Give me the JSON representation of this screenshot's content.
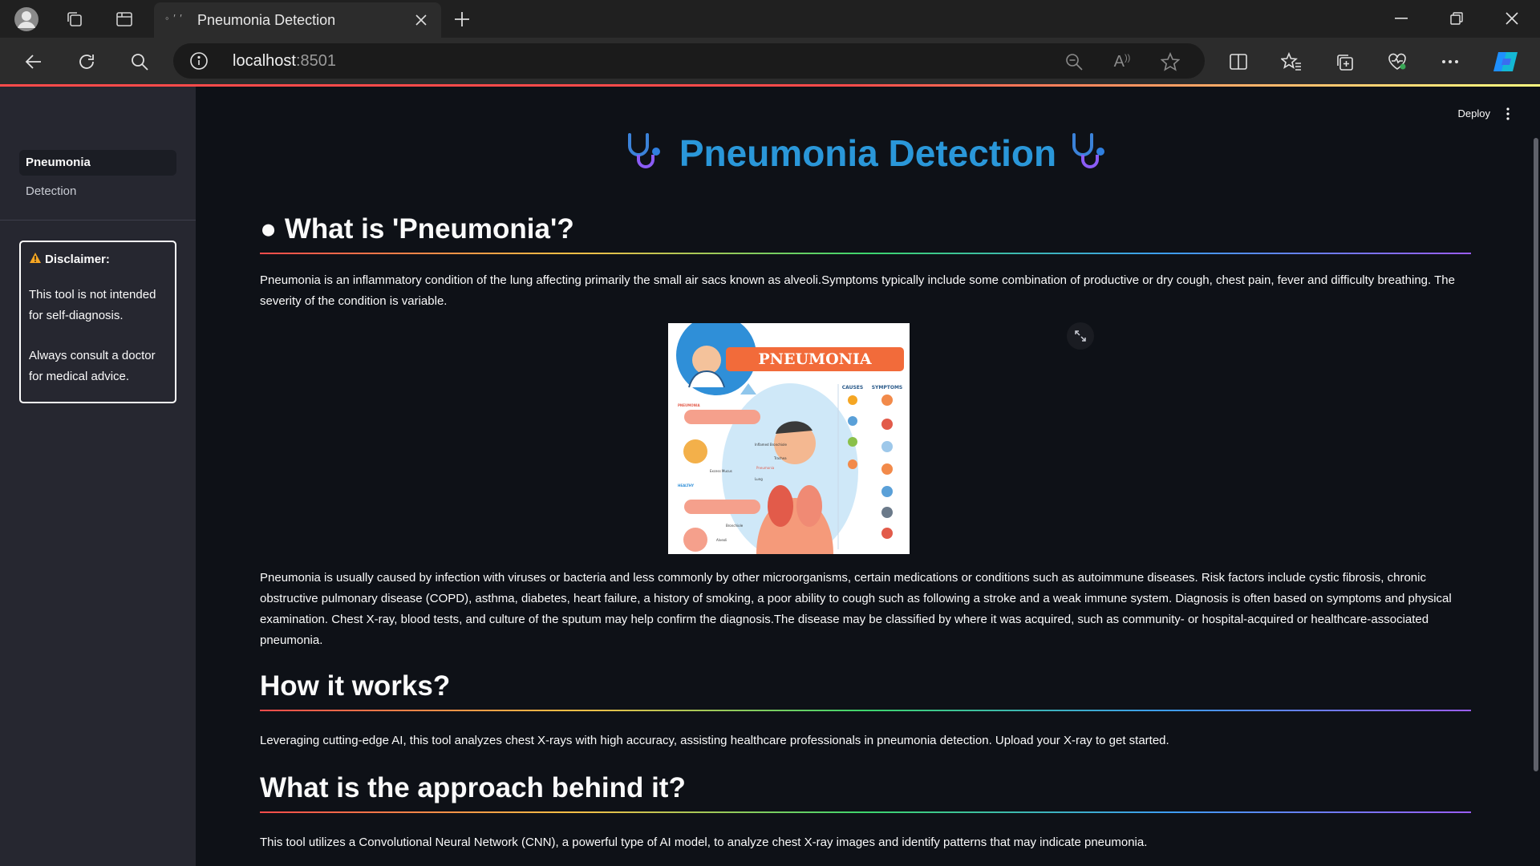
{
  "browser": {
    "tab_title": "Pneumonia Detection",
    "tab_favicon": "loading-icon",
    "url_host": "localhost",
    "url_port": ":8501"
  },
  "app": {
    "deploy_label": "Deploy",
    "title": "Pneumonia Detection",
    "title_icon": "stethoscope-icon"
  },
  "sidebar": {
    "nav": [
      {
        "label": "Pneumonia",
        "active": true
      },
      {
        "label": "Detection",
        "active": false
      }
    ],
    "disclaimer": {
      "heading": "Disclaimer:",
      "line1": "This tool is not intended for self-diagnosis.",
      "line2": "Always consult a doctor for medical advice."
    }
  },
  "main": {
    "section1": {
      "heading": "● What is 'Pneumonia'?",
      "para1": "Pneumonia is an inflammatory condition of the lung affecting primarily the small air sacs known as alveoli.Symptoms typically include some combination of productive or dry cough, chest pain, fever and difficulty breathing. The severity of the condition is variable.",
      "para2": "Pneumonia is usually caused by infection with viruses or bacteria and less commonly by other microorganisms, certain medications or conditions such as autoimmune diseases. Risk factors include cystic fibrosis, chronic obstructive pulmonary disease (COPD), asthma, diabetes, heart failure, a history of smoking, a poor ability to cough such as following a stroke and a weak immune system. Diagnosis is often based on symptoms and physical examination. Chest X-ray, blood tests, and culture of the sputum may help confirm the diagnosis.The disease may be classified by where it was acquired, such as community- or hospital-acquired or healthcare-associated pneumonia."
    },
    "figure": {
      "banner": "PNEUMONIA",
      "causes_label": "CAUSES",
      "symptoms_label": "SYMPTOMS",
      "pneumonia_label": "PNEUMONIA",
      "healthy_label": "HEALTHY",
      "labels": [
        "Inflamed Bronchiole",
        "Trachea",
        "Pneumonia",
        "Lung",
        "Excess Mucus",
        "Bronchiole",
        "Alveoli"
      ]
    },
    "section2": {
      "heading": "How it works?",
      "para": "Leveraging cutting-edge AI, this tool analyzes chest X-rays with high accuracy, assisting healthcare professionals in pneumonia detection. Upload your X-ray to get started."
    },
    "section3": {
      "heading": "What is the approach behind it?",
      "para": "This tool utilizes a Convolutional Neural Network (CNN), a powerful type of AI model, to analyze chest X-ray images and identify patterns that may indicate pneumonia."
    }
  },
  "colors": {
    "title_blue": "#2a97d9",
    "app_bg": "#0e1117",
    "sidebar_bg": "#262730",
    "accent_red": "#ff4b4b"
  }
}
